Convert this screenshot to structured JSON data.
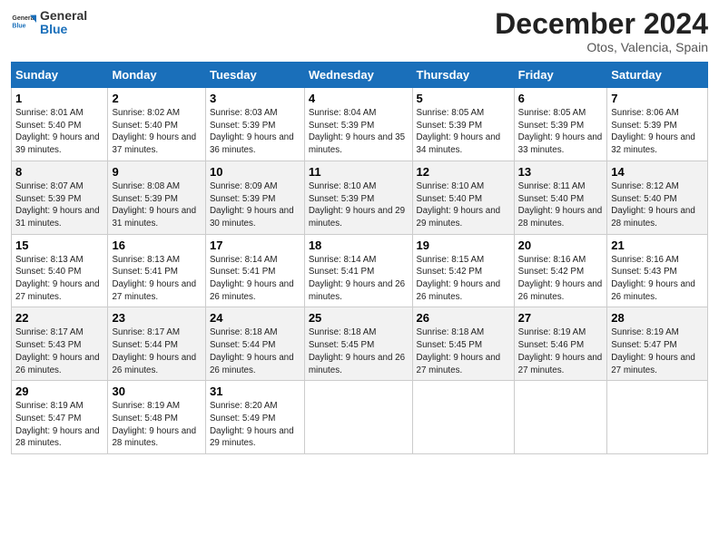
{
  "header": {
    "logo_text_general": "General",
    "logo_text_blue": "Blue",
    "title": "December 2024",
    "location": "Otos, Valencia, Spain"
  },
  "days_of_week": [
    "Sunday",
    "Monday",
    "Tuesday",
    "Wednesday",
    "Thursday",
    "Friday",
    "Saturday"
  ],
  "weeks": [
    [
      {
        "day": "1",
        "sunrise": "Sunrise: 8:01 AM",
        "sunset": "Sunset: 5:40 PM",
        "daylight": "Daylight: 9 hours and 39 minutes."
      },
      {
        "day": "2",
        "sunrise": "Sunrise: 8:02 AM",
        "sunset": "Sunset: 5:40 PM",
        "daylight": "Daylight: 9 hours and 37 minutes."
      },
      {
        "day": "3",
        "sunrise": "Sunrise: 8:03 AM",
        "sunset": "Sunset: 5:39 PM",
        "daylight": "Daylight: 9 hours and 36 minutes."
      },
      {
        "day": "4",
        "sunrise": "Sunrise: 8:04 AM",
        "sunset": "Sunset: 5:39 PM",
        "daylight": "Daylight: 9 hours and 35 minutes."
      },
      {
        "day": "5",
        "sunrise": "Sunrise: 8:05 AM",
        "sunset": "Sunset: 5:39 PM",
        "daylight": "Daylight: 9 hours and 34 minutes."
      },
      {
        "day": "6",
        "sunrise": "Sunrise: 8:05 AM",
        "sunset": "Sunset: 5:39 PM",
        "daylight": "Daylight: 9 hours and 33 minutes."
      },
      {
        "day": "7",
        "sunrise": "Sunrise: 8:06 AM",
        "sunset": "Sunset: 5:39 PM",
        "daylight": "Daylight: 9 hours and 32 minutes."
      }
    ],
    [
      {
        "day": "8",
        "sunrise": "Sunrise: 8:07 AM",
        "sunset": "Sunset: 5:39 PM",
        "daylight": "Daylight: 9 hours and 31 minutes."
      },
      {
        "day": "9",
        "sunrise": "Sunrise: 8:08 AM",
        "sunset": "Sunset: 5:39 PM",
        "daylight": "Daylight: 9 hours and 31 minutes."
      },
      {
        "day": "10",
        "sunrise": "Sunrise: 8:09 AM",
        "sunset": "Sunset: 5:39 PM",
        "daylight": "Daylight: 9 hours and 30 minutes."
      },
      {
        "day": "11",
        "sunrise": "Sunrise: 8:10 AM",
        "sunset": "Sunset: 5:39 PM",
        "daylight": "Daylight: 9 hours and 29 minutes."
      },
      {
        "day": "12",
        "sunrise": "Sunrise: 8:10 AM",
        "sunset": "Sunset: 5:40 PM",
        "daylight": "Daylight: 9 hours and 29 minutes."
      },
      {
        "day": "13",
        "sunrise": "Sunrise: 8:11 AM",
        "sunset": "Sunset: 5:40 PM",
        "daylight": "Daylight: 9 hours and 28 minutes."
      },
      {
        "day": "14",
        "sunrise": "Sunrise: 8:12 AM",
        "sunset": "Sunset: 5:40 PM",
        "daylight": "Daylight: 9 hours and 28 minutes."
      }
    ],
    [
      {
        "day": "15",
        "sunrise": "Sunrise: 8:13 AM",
        "sunset": "Sunset: 5:40 PM",
        "daylight": "Daylight: 9 hours and 27 minutes."
      },
      {
        "day": "16",
        "sunrise": "Sunrise: 8:13 AM",
        "sunset": "Sunset: 5:41 PM",
        "daylight": "Daylight: 9 hours and 27 minutes."
      },
      {
        "day": "17",
        "sunrise": "Sunrise: 8:14 AM",
        "sunset": "Sunset: 5:41 PM",
        "daylight": "Daylight: 9 hours and 26 minutes."
      },
      {
        "day": "18",
        "sunrise": "Sunrise: 8:14 AM",
        "sunset": "Sunset: 5:41 PM",
        "daylight": "Daylight: 9 hours and 26 minutes."
      },
      {
        "day": "19",
        "sunrise": "Sunrise: 8:15 AM",
        "sunset": "Sunset: 5:42 PM",
        "daylight": "Daylight: 9 hours and 26 minutes."
      },
      {
        "day": "20",
        "sunrise": "Sunrise: 8:16 AM",
        "sunset": "Sunset: 5:42 PM",
        "daylight": "Daylight: 9 hours and 26 minutes."
      },
      {
        "day": "21",
        "sunrise": "Sunrise: 8:16 AM",
        "sunset": "Sunset: 5:43 PM",
        "daylight": "Daylight: 9 hours and 26 minutes."
      }
    ],
    [
      {
        "day": "22",
        "sunrise": "Sunrise: 8:17 AM",
        "sunset": "Sunset: 5:43 PM",
        "daylight": "Daylight: 9 hours and 26 minutes."
      },
      {
        "day": "23",
        "sunrise": "Sunrise: 8:17 AM",
        "sunset": "Sunset: 5:44 PM",
        "daylight": "Daylight: 9 hours and 26 minutes."
      },
      {
        "day": "24",
        "sunrise": "Sunrise: 8:18 AM",
        "sunset": "Sunset: 5:44 PM",
        "daylight": "Daylight: 9 hours and 26 minutes."
      },
      {
        "day": "25",
        "sunrise": "Sunrise: 8:18 AM",
        "sunset": "Sunset: 5:45 PM",
        "daylight": "Daylight: 9 hours and 26 minutes."
      },
      {
        "day": "26",
        "sunrise": "Sunrise: 8:18 AM",
        "sunset": "Sunset: 5:45 PM",
        "daylight": "Daylight: 9 hours and 27 minutes."
      },
      {
        "day": "27",
        "sunrise": "Sunrise: 8:19 AM",
        "sunset": "Sunset: 5:46 PM",
        "daylight": "Daylight: 9 hours and 27 minutes."
      },
      {
        "day": "28",
        "sunrise": "Sunrise: 8:19 AM",
        "sunset": "Sunset: 5:47 PM",
        "daylight": "Daylight: 9 hours and 27 minutes."
      }
    ],
    [
      {
        "day": "29",
        "sunrise": "Sunrise: 8:19 AM",
        "sunset": "Sunset: 5:47 PM",
        "daylight": "Daylight: 9 hours and 28 minutes."
      },
      {
        "day": "30",
        "sunrise": "Sunrise: 8:19 AM",
        "sunset": "Sunset: 5:48 PM",
        "daylight": "Daylight: 9 hours and 28 minutes."
      },
      {
        "day": "31",
        "sunrise": "Sunrise: 8:20 AM",
        "sunset": "Sunset: 5:49 PM",
        "daylight": "Daylight: 9 hours and 29 minutes."
      },
      {
        "day": "",
        "sunrise": "",
        "sunset": "",
        "daylight": ""
      },
      {
        "day": "",
        "sunrise": "",
        "sunset": "",
        "daylight": ""
      },
      {
        "day": "",
        "sunrise": "",
        "sunset": "",
        "daylight": ""
      },
      {
        "day": "",
        "sunrise": "",
        "sunset": "",
        "daylight": ""
      }
    ]
  ]
}
